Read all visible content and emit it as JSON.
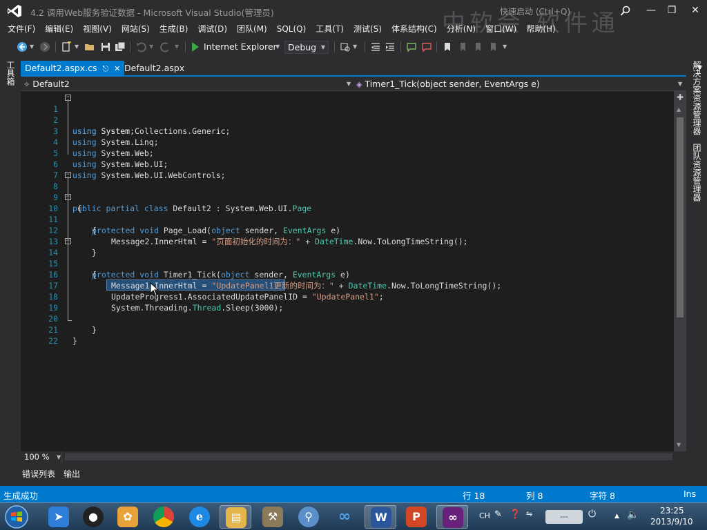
{
  "window": {
    "title": "4.2  调用Web服务验证数据 - Microsoft Visual Studio(管理员)",
    "quick_launch_placeholder": "快速启动 (Ctrl+Q)",
    "watermark": "中软会 软件通"
  },
  "menu": [
    "文件(F)",
    "编辑(E)",
    "视图(V)",
    "网站(S)",
    "生成(B)",
    "调试(D)",
    "团队(M)",
    "SQL(Q)",
    "工具(T)",
    "测试(S)",
    "体系结构(C)",
    "分析(N)",
    "窗口(W)",
    "帮助(H)"
  ],
  "toolbar": {
    "run_target": "Internet Explorer",
    "configuration": "Debug"
  },
  "left_panel": {
    "toolbox": "工具箱"
  },
  "right_panels": [
    "解决方案资源管理器",
    "团队资源管理器"
  ],
  "tabs": [
    {
      "label": "Default2.aspx.cs",
      "active": true
    },
    {
      "label": "Default2.aspx",
      "active": false
    }
  ],
  "nav": {
    "class_combo": "Default2",
    "member_combo": "Timer1_Tick(object sender, EventArgs e)"
  },
  "code": {
    "line_numbers": [
      "1",
      "2",
      "3",
      "4",
      "5",
      "6",
      "7",
      "8",
      "9",
      "10",
      "11",
      "12",
      "13",
      "14",
      "15",
      "16",
      "17",
      "18",
      "19",
      "20",
      "21",
      "22"
    ],
    "lines": {
      "l1_kw": "using",
      "l1_rest": " System;",
      "l2_kw": "using",
      "l2_rest": " System.Collections.Generic;",
      "l3_kw": "using",
      "l3_rest": " System.Linq;",
      "l4_kw": "using",
      "l4_rest": " System.Web;",
      "l5_kw": "using",
      "l5_rest": " System.Web.UI;",
      "l6_kw": "using",
      "l6_rest": " System.Web.UI.WebControls;",
      "l8_kw": "public partial class",
      "l8_name": " Default2 : System.Web.UI.",
      "l8_type": "Page",
      "l9": " {",
      "l10_kw": "protected void",
      "l10_name": " Page_Load(",
      "l10_kw2": "object",
      "l10_mid": " sender, ",
      "l10_type": "EventArgs",
      "l10_end": " e)",
      "l11": "{",
      "l12_a": "Message2.InnerHtml = ",
      "l12_str": "\"页面初始化的时间为：\"",
      "l12_b": " + ",
      "l12_type": "DateTime",
      "l12_c": ".Now.ToLongTimeString();",
      "l13": "}",
      "l14_kw": "protected void",
      "l14_name": " Timer1_Tick(",
      "l14_kw2": "object",
      "l14_mid": " sender, ",
      "l14_type": "EventArgs",
      "l14_end": " e)",
      "l15": "{",
      "l16_a": "Message1.InnerHtml = ",
      "l16_str": "\"UpdatePanel1更新的时间为：\"",
      "l16_b": " + ",
      "l16_type": "DateTime",
      "l16_c": ".Now.ToLongTimeString();",
      "l17_a": "UpdateProgress1.AssociatedUpdatePanelID = ",
      "l17_str": "\"UpdatePanel1\"",
      "l17_b": ";",
      "l18_a": "System.Threading.",
      "l18_type": "Thread",
      "l18_b": ".Sleep(3000);",
      "l20": "}",
      "l21": "}"
    }
  },
  "editor_footer": {
    "zoom": "100 %"
  },
  "bottom_tabs": [
    "错误列表",
    "输出"
  ],
  "status": {
    "message": "生成成功",
    "row": "行 18",
    "col": "列 8",
    "char": "字符 8",
    "mode": "Ins"
  },
  "taskbar": {
    "lang": "CH",
    "time": "23:25",
    "date": "2013/9/10"
  },
  "colors": {
    "accent": "#007acc",
    "keyword": "#569cd6",
    "type": "#4ec9b0",
    "string": "#d69d85",
    "line_number": "#2b91af"
  }
}
